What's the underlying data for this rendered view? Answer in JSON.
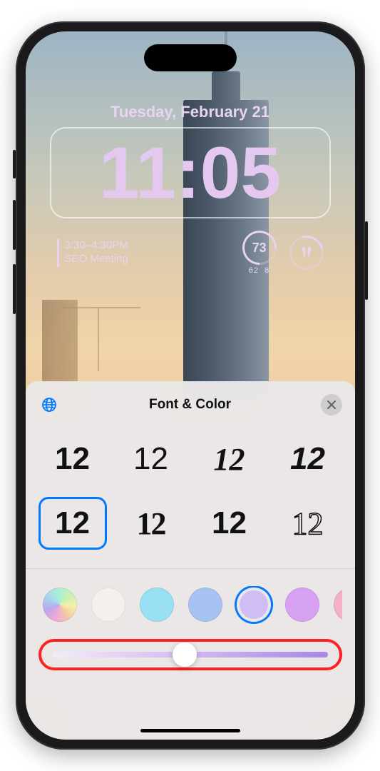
{
  "lockscreen": {
    "date": "Tuesday, February 21",
    "time": "11:05",
    "calendar": {
      "time_range": "3:30–4:30PM",
      "title": "SEO Meeting"
    },
    "weather": {
      "temp": "73",
      "low": "62",
      "high": "8"
    }
  },
  "sheet": {
    "title": "Font & Color",
    "font_sample": "12",
    "font_options": [
      "12",
      "12",
      "12",
      "12",
      "12",
      "12",
      "12",
      "12"
    ],
    "selected_font_index": 4,
    "colors": [
      {
        "name": "rainbow",
        "hex": "rainbow"
      },
      {
        "name": "white",
        "hex": "#f4f1ed"
      },
      {
        "name": "cyan",
        "hex": "#99e0f5"
      },
      {
        "name": "blue",
        "hex": "#a7c2f2"
      },
      {
        "name": "lavender",
        "hex": "#cfbdf4"
      },
      {
        "name": "purple",
        "hex": "#d7a2f2"
      },
      {
        "name": "pink",
        "hex": "#f4b0ca"
      }
    ],
    "selected_color_index": 4,
    "slider_value": 48
  },
  "annotations": {
    "slider_highlight": "#ff2020"
  }
}
